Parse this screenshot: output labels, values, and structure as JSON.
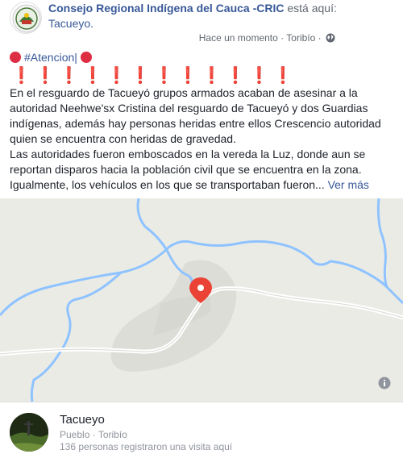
{
  "post": {
    "page_name": "Consejo Regional Indígena del Cauca -CRIC",
    "is_here": " está aquí: ",
    "place": "Tacueyo.",
    "time": "Hace un momento",
    "separator": "·",
    "location": "Toribío",
    "alert_hashtag": "#Atencion|",
    "exclamations": "❗❗❗❗❗❗❗❗❗❗❗❗",
    "paragraph1": "En el resguardo de Tacueyó grupos armados acaban de asesinar a la autoridad Neehwe'sx Cristina del resguardo de Tacueyó y dos Guardias indígenas, además hay personas heridas entre ellos Crescencio autoridad quien se encuentra con heridas de gravedad.",
    "paragraph2": "Las autoridades fueron emboscados en la vereda la Luz, donde aun se reportan disparos hacia la población civil que se encuentra en la zona. Igualmente, los vehículos en los que se transportaban fueron...",
    "see_more": "Ver más"
  },
  "place_card": {
    "name": "Tacueyo",
    "type_line": "Pueblo · Toribío",
    "visits": "136 personas registraron una visita aquí"
  },
  "colors": {
    "link": "#385898",
    "alert_red": "#dd2e44",
    "map_bg": "#ebebe6",
    "river": "#8ec3ff",
    "pin": "#ea4335"
  },
  "icons": [
    "globe-icon",
    "map-pin-icon",
    "info-icon",
    "red-circle-icon"
  ]
}
